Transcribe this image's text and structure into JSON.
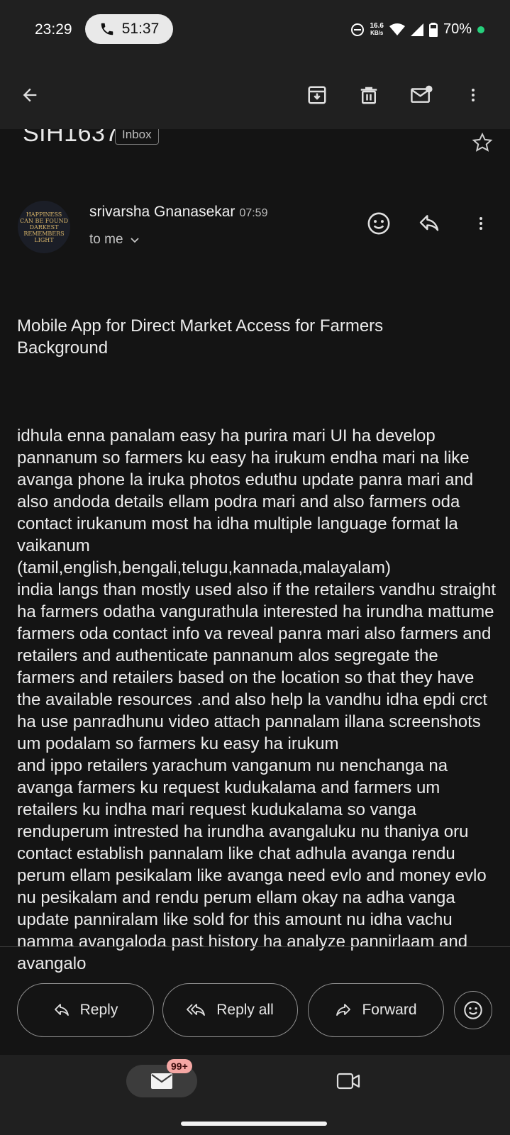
{
  "status_bar": {
    "time": "23:29",
    "call_duration": "51:37",
    "network_speed_value": "16.6",
    "network_speed_unit": "KB/s",
    "battery": "70%",
    "icons": [
      "phone-icon",
      "dnd-icon",
      "wifi-icon",
      "signal-icon",
      "battery-icon"
    ]
  },
  "toolbar": {
    "icons": [
      "back-arrow-icon",
      "archive-icon",
      "delete-icon",
      "mark-unread-icon",
      "more-vert-icon"
    ]
  },
  "email": {
    "subject": "SIH1637",
    "label": "Inbox",
    "sender": "srivarsha Gnanasekar",
    "time": "07:59",
    "recipient": "to me",
    "avatar_text": [
      "HAPPINESS",
      "CAN BE FOUND",
      "IN THE",
      "DARKEST",
      "OF TIMES",
      "IF ONE ONLY",
      "REMEMBERS",
      "TO TURN",
      "ON THE",
      "LIGHT"
    ],
    "title_line": "Mobile App for Direct Market Access for Farmers\nBackground",
    "body": "idhula enna panalam easy ha purira mari UI ha develop pannanum so farmers ku easy ha irukum endha mari na like avanga phone la iruka photos eduthu update panra mari and also andoda details ellam podra mari and also farmers oda contact irukanum most ha idha multiple language format la vaikanum\n(tamil,english,bengali,telugu,kannada,malayalam)\nindia langs than mostly used also if the retailers vandhu straight ha farmers odatha vangurathula interested ha irundha mattume farmers oda contact info va reveal panra mari also farmers and retailers and authenticate pannanum alos segregate the farmers and retailers based on the location so that they have the available resources .and also help la vandhu idha epdi crct ha use panradhunu video attach pannalam illana screenshots um podalam so farmers ku easy ha irukum\nand ippo retailers yarachum vanganum nu nenchanga na avanga farmers ku request kudukalama and farmers um retailers ku indha mari request kudukalama so vanga renduperum intrested ha irundha avangaluku nu thaniya oru contact establish pannalam like chat adhula avanga rendu perum ellam pesikalam like avanga need evlo and money evlo nu pesikalam and rendu perum ellam okay na adha vanga update panniralam like sold for this amount nu idha vachu namma avangaloda past history ha analyze pannirlaam and avangalo"
  },
  "actions": {
    "reply": "Reply",
    "reply_all": "Reply all",
    "forward": "Forward"
  },
  "bottom_nav": {
    "mail_badge": "99+"
  },
  "colors": {
    "background": "#141414",
    "bar": "#202020",
    "text": "#ececec",
    "badge": "#f5a7a4",
    "battery_dot": "#26d07c"
  }
}
